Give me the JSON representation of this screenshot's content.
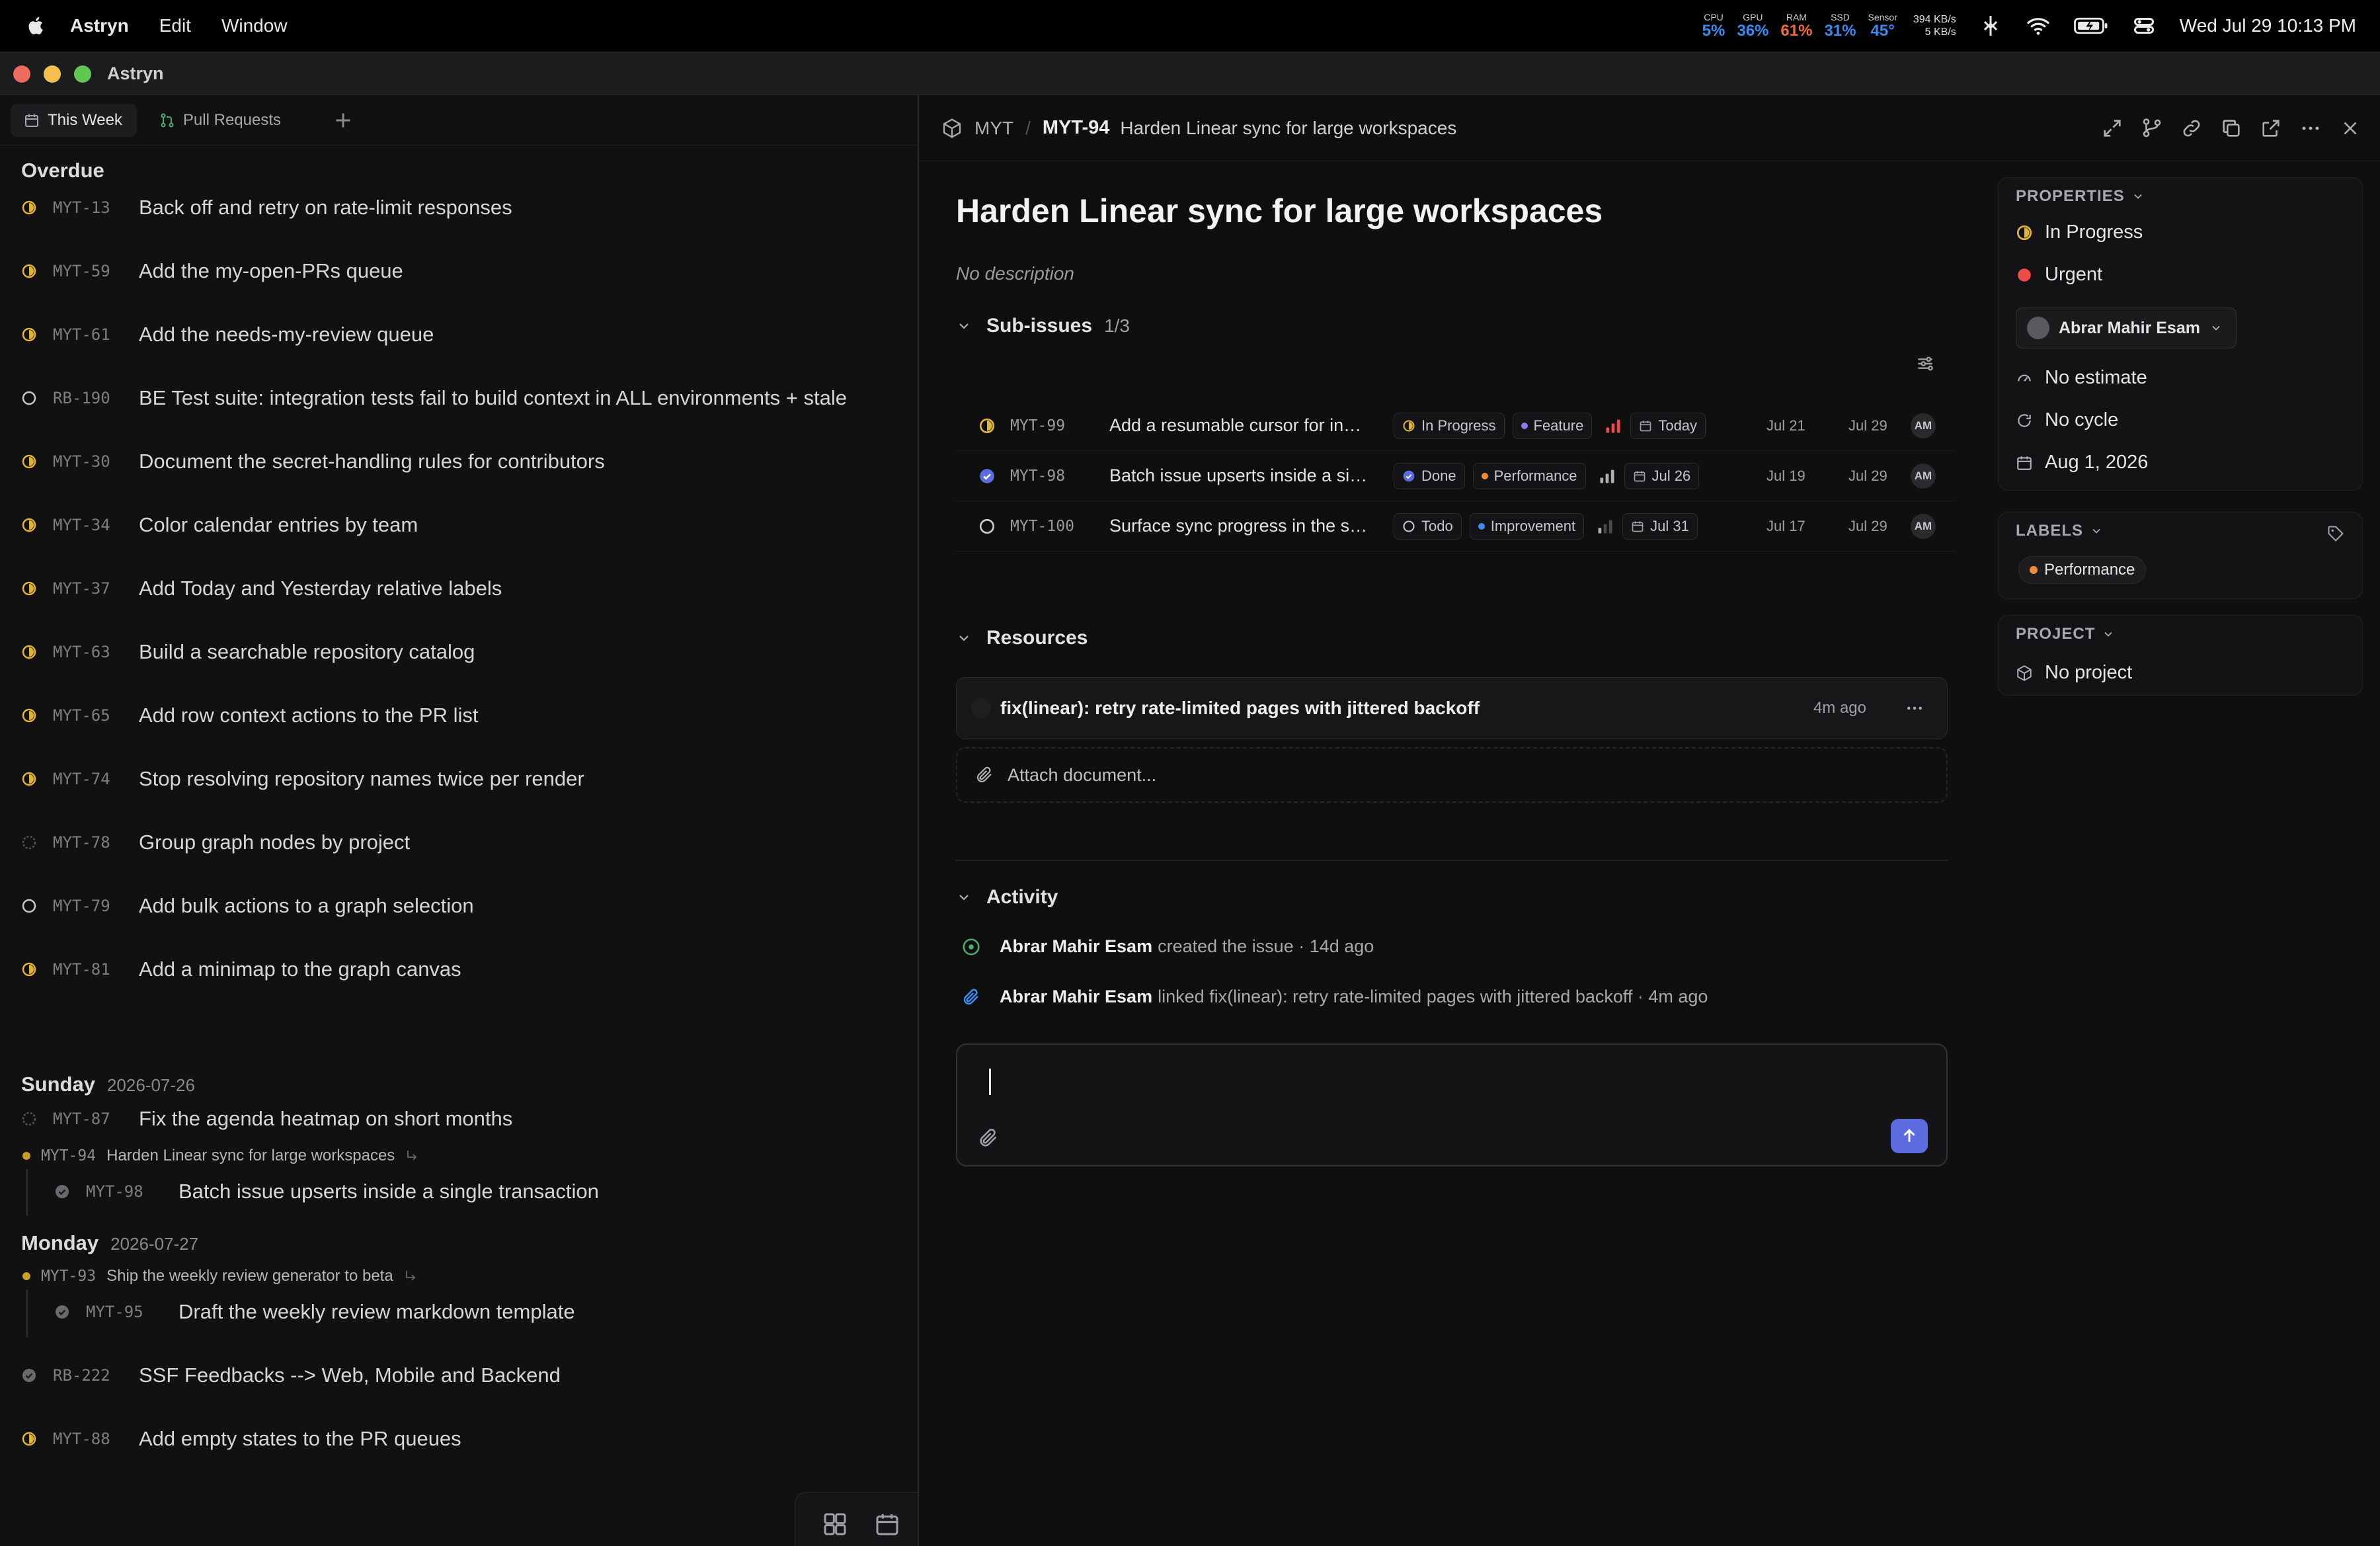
{
  "menubar": {
    "app_name": "Astryn",
    "items": [
      "Edit",
      "Window"
    ],
    "stats": [
      {
        "label": "CPU",
        "value": "5%",
        "color": "#3b8cf0"
      },
      {
        "label": "GPU",
        "value": "36%",
        "color": "#3b8cf0"
      },
      {
        "label": "RAM",
        "value": "61%",
        "color": "#f06b3b"
      },
      {
        "label": "SSD",
        "value": "31%",
        "color": "#3b8cf0"
      },
      {
        "label": "Sensor",
        "value": "45°",
        "color": "#3b8cf0"
      }
    ],
    "net_up": "394 KB/s",
    "net_down": "5 KB/s",
    "clock": "Wed Jul 29  10:13 PM"
  },
  "window": {
    "title": "Astryn"
  },
  "tabs": [
    {
      "label": "This Week",
      "icon": "calendar-icon"
    },
    {
      "label": "Pull Requests",
      "icon": "pull-request-icon"
    }
  ],
  "agenda": {
    "overdue_label": "Overdue",
    "overdue": [
      {
        "id": "MYT-13",
        "title": "Back off and retry on rate-limit responses",
        "status": "in-progress"
      },
      {
        "id": "MYT-59",
        "title": "Add the my-open-PRs queue",
        "status": "in-progress"
      },
      {
        "id": "MYT-61",
        "title": "Add the needs-my-review queue",
        "status": "in-progress"
      },
      {
        "id": "RB-190",
        "title": "BE Test suite: integration tests fail to build context in ALL environments + stale",
        "status": "todo"
      },
      {
        "id": "MYT-30",
        "title": "Document the secret-handling rules for contributors",
        "status": "in-progress"
      },
      {
        "id": "MYT-34",
        "title": "Color calendar entries by team",
        "status": "in-progress"
      },
      {
        "id": "MYT-37",
        "title": "Add Today and Yesterday relative labels",
        "status": "in-progress"
      },
      {
        "id": "MYT-63",
        "title": "Build a searchable repository catalog",
        "status": "in-progress"
      },
      {
        "id": "MYT-65",
        "title": "Add row context actions to the PR list",
        "status": "in-progress"
      },
      {
        "id": "MYT-74",
        "title": "Stop resolving repository names twice per render",
        "status": "in-progress"
      },
      {
        "id": "MYT-78",
        "title": "Group graph nodes by project",
        "status": "backlog"
      },
      {
        "id": "MYT-79",
        "title": "Add bulk actions to a graph selection",
        "status": "todo"
      },
      {
        "id": "MYT-81",
        "title": "Add a minimap to the graph canvas",
        "status": "in-progress"
      }
    ],
    "sunday": {
      "label": "Sunday",
      "date": "2026-07-26",
      "items": [
        {
          "id": "MYT-87",
          "title": "Fix the agenda heatmap on short months",
          "status": "backlog"
        }
      ],
      "parent": {
        "id": "MYT-94",
        "title": "Harden Linear sync for large workspaces"
      },
      "children": [
        {
          "id": "MYT-98",
          "title": "Batch issue upserts inside a single transaction",
          "status": "done"
        }
      ]
    },
    "monday": {
      "label": "Monday",
      "date": "2026-07-27",
      "parent": {
        "id": "MYT-93",
        "title": "Ship the weekly review generator to beta"
      },
      "children": [
        {
          "id": "MYT-95",
          "title": "Draft the weekly review markdown template",
          "status": "done"
        }
      ],
      "items": [
        {
          "id": "RB-222",
          "title": "SSF Feedbacks --> Web, Mobile and Backend",
          "status": "done"
        },
        {
          "id": "MYT-88",
          "title": "Add empty states to the PR queues",
          "status": "in-progress"
        }
      ]
    }
  },
  "detail": {
    "breadcrumb_project": "MYT",
    "issue_id": "MYT-94",
    "issue_title": "Harden Linear sync for large workspaces",
    "description_placeholder": "No description",
    "subissues_label": "Sub-issues",
    "subissues_count": "1/3",
    "subissues": [
      {
        "id": "MYT-99",
        "title": "Add a resumable cursor for in…",
        "status": "in-progress",
        "status_label": "In Progress",
        "label": "Feature",
        "label_color": "#8b7cf6",
        "priority": "urgent",
        "due": "Today",
        "start": "Jul 21",
        "end": "Jul 29",
        "assignee": "AM"
      },
      {
        "id": "MYT-98",
        "title": "Batch issue upserts inside a si…",
        "status": "done",
        "status_label": "Done",
        "label": "Performance",
        "label_color": "#f08a3b",
        "priority": "high",
        "due": "Jul 26",
        "start": "Jul 19",
        "end": "Jul 29",
        "assignee": "AM"
      },
      {
        "id": "MYT-100",
        "title": "Surface sync progress in the s…",
        "status": "todo",
        "status_label": "Todo",
        "label": "Improvement",
        "label_color": "#3b8cf0",
        "priority": "low",
        "due": "Jul 31",
        "start": "Jul 17",
        "end": "Jul 29",
        "assignee": "AM"
      }
    ],
    "resources_label": "Resources",
    "resource": {
      "title": "fix(linear): retry rate-limited pages with jittered backoff",
      "time": "4m ago"
    },
    "attach_label": "Attach document...",
    "activity_label": "Activity",
    "activity": [
      {
        "who": "Abrar Mahir Esam",
        "text": "created the issue · 14d ago",
        "icon": "created-icon"
      },
      {
        "who": "Abrar Mahir Esam",
        "text": "linked fix(linear): retry rate-limited pages with jittered backoff · 4m ago",
        "icon": "link-icon"
      }
    ]
  },
  "properties": {
    "header": "PROPERTIES",
    "status": "In Progress",
    "priority": "Urgent",
    "assignee": "Abrar Mahir Esam",
    "estimate": "No estimate",
    "cycle": "No cycle",
    "due_date": "Aug 1, 2026",
    "labels_header": "LABELS",
    "label": "Performance",
    "label_color": "#f08a3b",
    "project_header": "PROJECT",
    "project": "No project"
  },
  "colors": {
    "accent": "#5d6be0",
    "in_progress": "#e0b43a",
    "urgent": "#ef4b4b",
    "done": "#5d6be0"
  }
}
